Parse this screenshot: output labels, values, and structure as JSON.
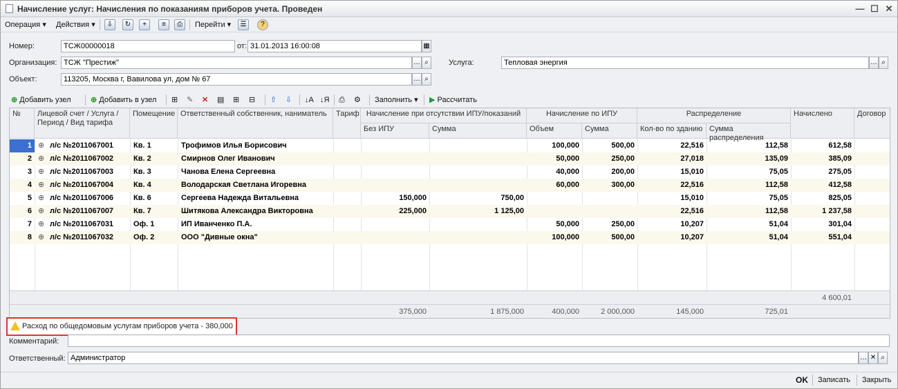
{
  "window": {
    "title": "Начисление услуг: Начисления по показаниям приборов учета. Проведен"
  },
  "toolbar": {
    "operation": "Операция",
    "actions": "Действия",
    "goto": "Перейти"
  },
  "form": {
    "number_label": "Номер:",
    "number_value": "ТСЖ00000018",
    "date_label": "от:",
    "date_value": "31.01.2013 16:00:08",
    "org_label": "Организация:",
    "org_value": "ТСЖ \"Престиж\"",
    "service_label": "Услуга:",
    "service_value": "Тепловая энергия",
    "object_label": "Объект:",
    "object_value": "113205, Москва г, Вавилова ул, дом № 67"
  },
  "gridbar": {
    "add_node": "Добавить узел",
    "add_to_node": "Добавить в узел",
    "fill": "Заполнить",
    "calculate": "Рассчитать"
  },
  "grid": {
    "headers": {
      "num": "№",
      "account": "Лицевой счет / Услуга / Период / Вид тарифа",
      "premise": "Помещение",
      "owner": "Ответственный собственник, наниматель",
      "tariff": "Тариф",
      "no_meter": "Начисление при отсутствии ИПУ/показаний",
      "no_meter_without": "Без ИПУ",
      "no_meter_sum": "Сумма",
      "meter": "Начисление по ИПУ",
      "meter_volume": "Объем",
      "meter_sum": "Сумма",
      "dist": "Распределение",
      "dist_qty": "Кол-во по зданию",
      "dist_sum": "Сумма распределения",
      "charged": "Начислено",
      "contract": "Договор"
    },
    "rows": [
      {
        "n": "1",
        "account": "л/с №2011067001",
        "premise": "Кв. 1",
        "owner": "Трофимов Илья Борисович",
        "no_ipu": "",
        "no_ipu_sum": "",
        "volume": "100,000",
        "ipu_sum": "500,00",
        "qty": "22,516",
        "dist_sum": "112,58",
        "charged": "612,58"
      },
      {
        "n": "2",
        "account": "л/с №2011067002",
        "premise": "Кв. 2",
        "owner": "Смирнов Олег Иванович",
        "no_ipu": "",
        "no_ipu_sum": "",
        "volume": "50,000",
        "ipu_sum": "250,00",
        "qty": "27,018",
        "dist_sum": "135,09",
        "charged": "385,09"
      },
      {
        "n": "3",
        "account": "л/с №2011067003",
        "premise": "Кв. 3",
        "owner": "Чанова Елена Сергеевна",
        "no_ipu": "",
        "no_ipu_sum": "",
        "volume": "40,000",
        "ipu_sum": "200,00",
        "qty": "15,010",
        "dist_sum": "75,05",
        "charged": "275,05"
      },
      {
        "n": "4",
        "account": "л/с №2011067004",
        "premise": "Кв. 4",
        "owner": "Володарская Светлана Игоревна",
        "no_ipu": "",
        "no_ipu_sum": "",
        "volume": "60,000",
        "ipu_sum": "300,00",
        "qty": "22,516",
        "dist_sum": "112,58",
        "charged": "412,58"
      },
      {
        "n": "5",
        "account": "л/с №2011067006",
        "premise": "Кв. 6",
        "owner": "Сергеева Надежда Витальевна",
        "no_ipu": "150,000",
        "no_ipu_sum": "750,00",
        "volume": "",
        "ipu_sum": "",
        "qty": "15,010",
        "dist_sum": "75,05",
        "charged": "825,05"
      },
      {
        "n": "6",
        "account": "л/с №2011067007",
        "premise": "Кв. 7",
        "owner": "Шитякова Александра Викторовна",
        "no_ipu": "225,000",
        "no_ipu_sum": "1 125,00",
        "volume": "",
        "ipu_sum": "",
        "qty": "22,516",
        "dist_sum": "112,58",
        "charged": "1 237,58"
      },
      {
        "n": "7",
        "account": "л/с №2011067031",
        "premise": "Оф. 1",
        "owner": "ИП Иванченко П.А.",
        "no_ipu": "",
        "no_ipu_sum": "",
        "volume": "50,000",
        "ipu_sum": "250,00",
        "qty": "10,207",
        "dist_sum": "51,04",
        "charged": "301,04"
      },
      {
        "n": "8",
        "account": "л/с №2011067032",
        "premise": "Оф. 2",
        "owner": "ООО \"Дивные окна\"",
        "no_ipu": "",
        "no_ipu_sum": "",
        "volume": "100,000",
        "ipu_sum": "500,00",
        "qty": "10,207",
        "dist_sum": "51,04",
        "charged": "551,04"
      }
    ],
    "totals": {
      "charged": "4 600,01",
      "no_ipu": "375,000",
      "no_ipu_sum": "1 875,000",
      "volume": "400,000",
      "ipu_sum": "2 000,000",
      "qty": "145,000",
      "dist_sum": "725,01"
    }
  },
  "warning": {
    "text": "Расход по общедомовым услугам приборов учета - 380,000"
  },
  "comment": {
    "label": "Комментарий:",
    "value": ""
  },
  "responsible": {
    "label": "Ответственный:",
    "value": "Администратор"
  },
  "bottom": {
    "ok": "OK",
    "save": "Записать",
    "close": "Закрыть"
  }
}
